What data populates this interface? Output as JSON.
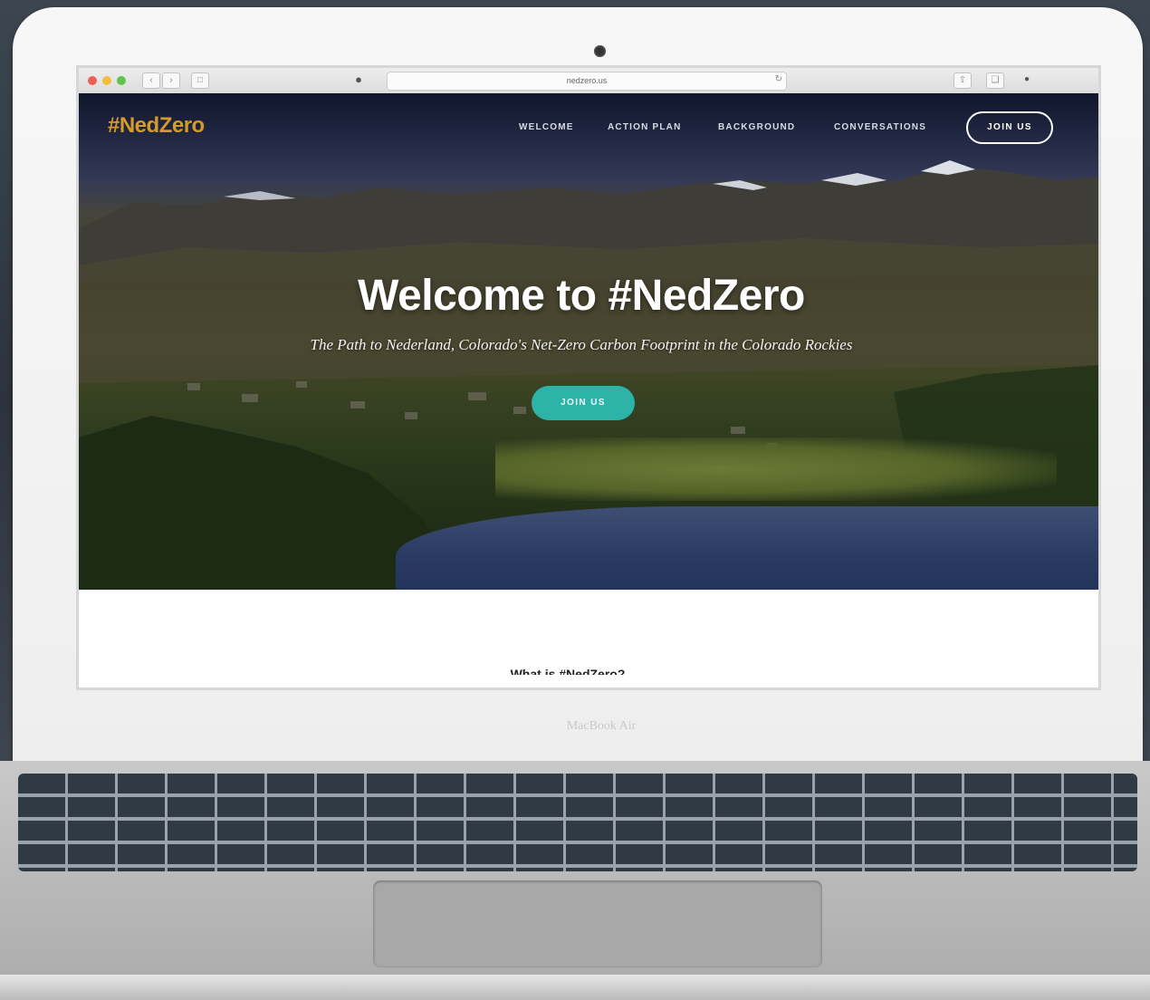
{
  "browser": {
    "address": "nedzero.us"
  },
  "site": {
    "logo": "#NedZero",
    "nav": [
      "WELCOME",
      "ACTION PLAN",
      "BACKGROUND",
      "CONVERSATIONS"
    ],
    "join_nav": "JOIN US"
  },
  "hero": {
    "title": "Welcome to #NedZero",
    "subtitle": "The Path to Nederland, Colorado's Net-Zero Carbon Footprint in the Colorado Rockies",
    "cta": "JOIN US"
  },
  "below_fold": {
    "heading": "What is #NedZero?"
  },
  "device": {
    "label": "MacBook Air"
  },
  "colors": {
    "logo": "#d49a2a",
    "cta": "#2eb3a9"
  }
}
